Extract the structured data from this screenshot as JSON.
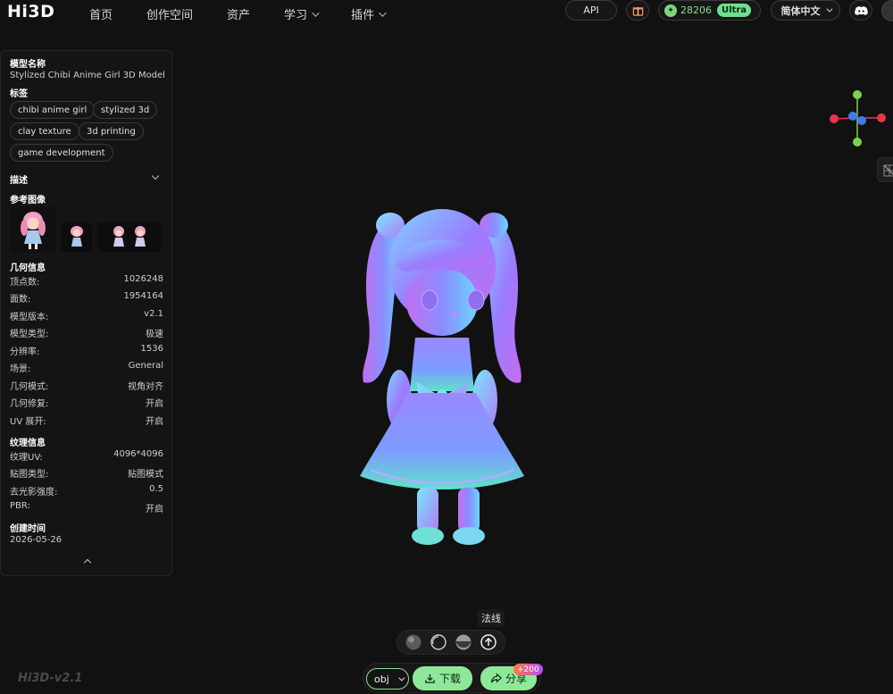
{
  "header": {
    "logo": "Hi3D",
    "nav": [
      {
        "label": "首页",
        "has_dropdown": false
      },
      {
        "label": "创作空间",
        "has_dropdown": false
      },
      {
        "label": "资产",
        "has_dropdown": false
      },
      {
        "label": "学习",
        "has_dropdown": true
      },
      {
        "label": "插件",
        "has_dropdown": true
      }
    ],
    "api_label": "API",
    "credits": "28206",
    "plan_badge": "Ultra",
    "language": "简体中文",
    "icons": [
      "gift-icon",
      "discord-icon",
      "avatar"
    ]
  },
  "panel": {
    "name_heading": "模型名称",
    "model_name": "Stylized Chibi Anime Girl 3D Model",
    "tags_heading": "标签",
    "tags": [
      "chibi anime girl",
      "stylized 3d",
      "clay texture",
      "3d printing",
      "game development"
    ],
    "description_heading": "描述",
    "ref_heading": "参考图像",
    "geometry_heading": "几何信息",
    "geometry": [
      {
        "label": "顶点数:",
        "value": "1026248"
      },
      {
        "label": "面数:",
        "value": "1954164"
      },
      {
        "label": "模型版本:",
        "value": "v2.1"
      },
      {
        "label": "模型类型:",
        "value": "极速"
      },
      {
        "label": "分辨率:",
        "value": "1536"
      },
      {
        "label": "场景:",
        "value": "General"
      },
      {
        "label": "几何模式:",
        "value": "视角对齐"
      },
      {
        "label": "几何修复:",
        "value": "开启"
      },
      {
        "label": "UV 展开:",
        "value": "开启"
      }
    ],
    "texture_heading": "纹理信息",
    "texture": [
      {
        "label": "纹理UV:",
        "value": "4096*4096"
      },
      {
        "label": "贴图类型:",
        "value": "贴图模式"
      },
      {
        "label": "去光影强度:",
        "value": "0.5"
      },
      {
        "label": "PBR:",
        "value": "开启"
      }
    ],
    "created_heading": "创建时间",
    "created_date": "2026-05-26"
  },
  "viewer": {
    "tooltip": "法线",
    "shading_modes": [
      "textured-mode-icon",
      "wireframe-mode-icon",
      "clay-mode-icon",
      "normal-mode-icon"
    ],
    "active_mode": "normal-mode-icon",
    "version_label": "Hi3D-v2.1"
  },
  "actions": {
    "format": "obj",
    "download_label": "下载",
    "share_label": "分享",
    "share_badge": "+200"
  },
  "colors": {
    "accent_green": "#8fe89a",
    "gizmo_x": "#e8344a",
    "gizmo_y": "#7bd24a",
    "gizmo_z": "#3a7de8",
    "background": "#111111"
  }
}
